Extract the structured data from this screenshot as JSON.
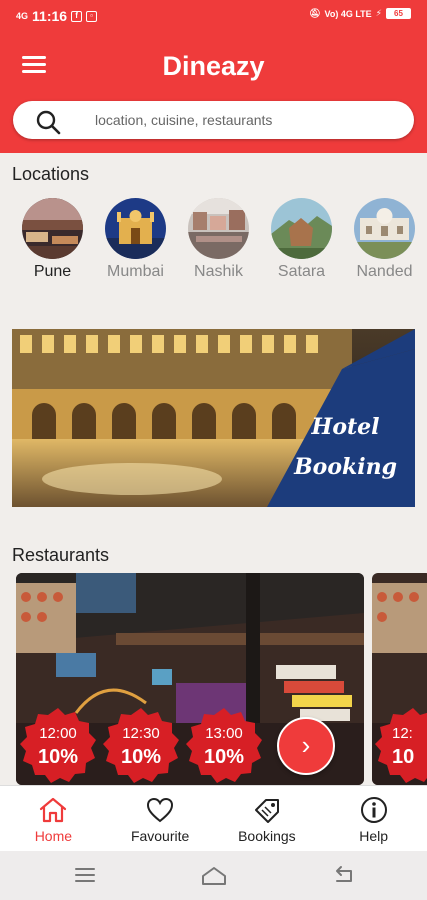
{
  "status_bar": {
    "time": "11:16",
    "signal": "4G",
    "right_text": "Vo) 4G LTE",
    "battery": "65"
  },
  "app_bar": {
    "title": "Dineazy"
  },
  "search": {
    "placeholder": "location, cuisine, restaurants"
  },
  "locations": {
    "heading": "Locations",
    "items": [
      {
        "label": "Pune",
        "active": true
      },
      {
        "label": "Mumbai",
        "active": false
      },
      {
        "label": "Nashik",
        "active": false
      },
      {
        "label": "Satara",
        "active": false
      },
      {
        "label": "Nanded",
        "active": false
      }
    ]
  },
  "banner": {
    "line1": "Hotel",
    "line2": "Booking"
  },
  "restaurants": {
    "heading": "Restaurants",
    "slots": [
      {
        "time": "12:00",
        "discount": "10%"
      },
      {
        "time": "12:30",
        "discount": "10%"
      },
      {
        "time": "13:00",
        "discount": "10%"
      }
    ],
    "next_card_slot": {
      "time": "12:",
      "discount": "10"
    },
    "next_icon": "chevron-right-icon"
  },
  "bottom_nav": {
    "items": [
      {
        "label": "Home",
        "icon": "home-icon",
        "active": true
      },
      {
        "label": "Favourite",
        "icon": "heart-icon",
        "active": false
      },
      {
        "label": "Bookings",
        "icon": "tag-icon",
        "active": false
      },
      {
        "label": "Help",
        "icon": "info-icon",
        "active": false
      }
    ]
  },
  "colors": {
    "primary": "#ef3b3b",
    "background": "#f1eeeb",
    "banner_blue": "#1c3c7c"
  }
}
